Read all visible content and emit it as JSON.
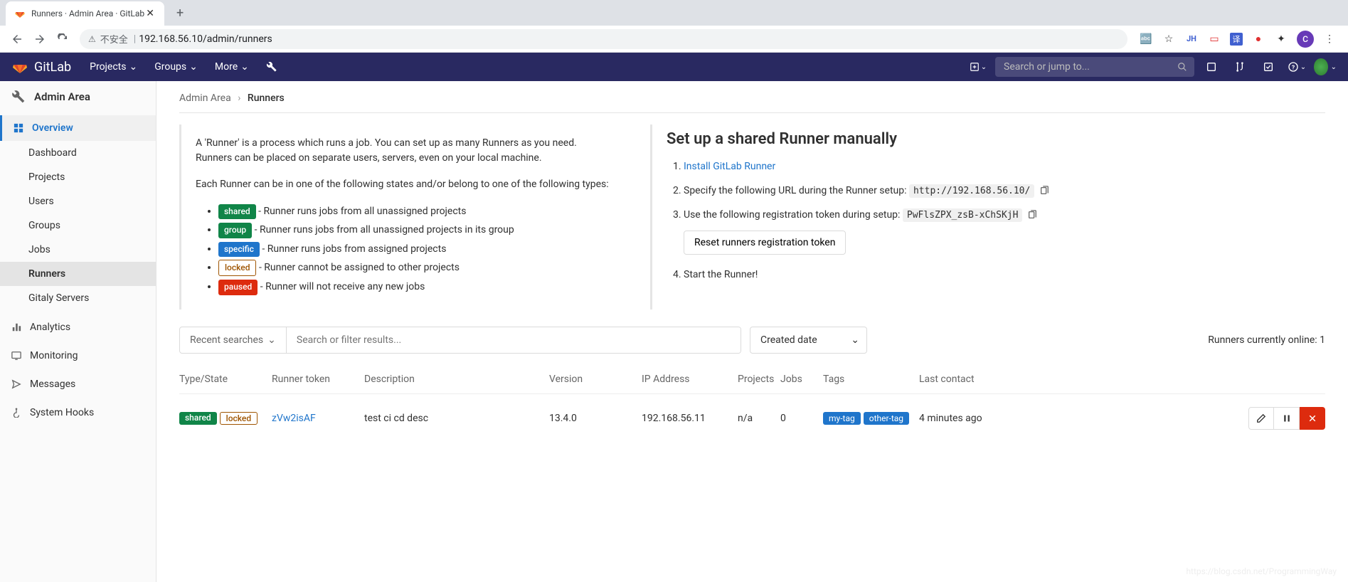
{
  "browser": {
    "tab_title": "Runners · Admin Area · GitLab",
    "warn_label": "不安全",
    "url": "192.168.56.10/admin/runners",
    "avatar_letter": "C"
  },
  "header": {
    "brand": "GitLab",
    "nav": {
      "projects": "Projects",
      "groups": "Groups",
      "more": "More"
    },
    "search_placeholder": "Search or jump to..."
  },
  "sidebar": {
    "title": "Admin Area",
    "overview_label": "Overview",
    "items": [
      "Dashboard",
      "Projects",
      "Users",
      "Groups",
      "Jobs",
      "Runners",
      "Gitaly Servers"
    ],
    "analytics": "Analytics",
    "monitoring": "Monitoring",
    "messages": "Messages",
    "hooks": "System Hooks"
  },
  "breadcrumb": {
    "root": "Admin Area",
    "current": "Runners"
  },
  "info": {
    "p1": "A 'Runner' is a process which runs a job. You can set up as many Runners as you need. Runners can be placed on separate users, servers, even on your local machine.",
    "p2": "Each Runner can be in one of the following states and/or belong to one of the following types:",
    "badges": {
      "shared": "shared",
      "shared_desc": " - Runner runs jobs from all unassigned projects",
      "group": "group",
      "group_desc": " - Runner runs jobs from all unassigned projects in its group",
      "specific": "specific",
      "specific_desc": " - Runner runs jobs from assigned projects",
      "locked": "locked",
      "locked_desc": " - Runner cannot be assigned to other projects",
      "paused": "paused",
      "paused_desc": " - Runner will not receive any new jobs"
    }
  },
  "setup": {
    "title": "Set up a shared Runner manually",
    "step1_link": "Install GitLab Runner",
    "step2": "Specify the following URL during the Runner setup: ",
    "step2_url": "http://192.168.56.10/",
    "step3": "Use the following registration token during setup: ",
    "step3_token": "PwFlsZPX_zsB-xChSKjH",
    "reset_btn": "Reset runners registration token",
    "step4": "Start the Runner!"
  },
  "filter": {
    "recent": "Recent searches",
    "placeholder": "Search or filter results...",
    "sort": "Created date",
    "online": "Runners currently online: 1"
  },
  "table": {
    "headers": {
      "type": "Type/State",
      "token": "Runner token",
      "desc": "Description",
      "ver": "Version",
      "ip": "IP Address",
      "proj": "Projects",
      "jobs": "Jobs",
      "tags": "Tags",
      "last": "Last contact"
    },
    "rows": [
      {
        "badges": [
          "shared",
          "locked"
        ],
        "token": "zVw2isAF",
        "desc": "test ci cd desc",
        "ver": "13.4.0",
        "ip": "192.168.56.11",
        "proj": "n/a",
        "jobs": "0",
        "tags": [
          "my-tag",
          "other-tag"
        ],
        "last": "4 minutes ago"
      }
    ]
  },
  "watermark": "https://blog.csdn.net/ProgrammingWay"
}
